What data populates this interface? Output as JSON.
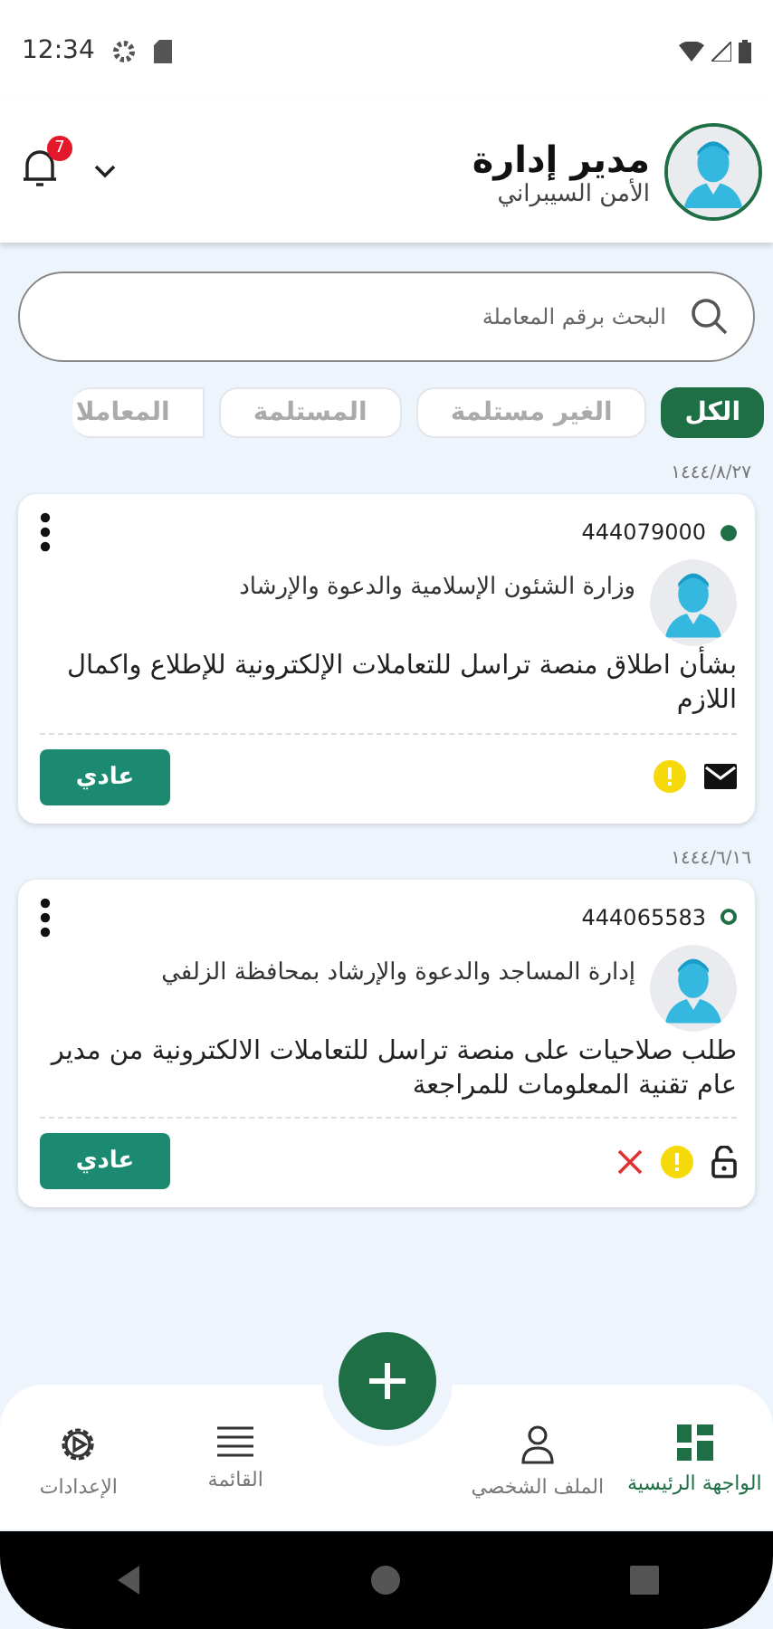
{
  "status_bar": {
    "time": "12:34"
  },
  "header": {
    "title": "مدير إدارة",
    "subtitle": "الأمن السيبراني",
    "notifications": "7"
  },
  "search": {
    "placeholder": "البحث برقم المعاملة"
  },
  "tabs": [
    {
      "label": "الكل",
      "selected": true
    },
    {
      "label": "الغير مستلمة",
      "selected": false
    },
    {
      "label": "المستلمة",
      "selected": false
    },
    {
      "label": "المعاملا",
      "selected": false
    }
  ],
  "transactions": [
    {
      "date": "١٤٤٤/٨/٢٧",
      "number": "444079000",
      "dot_filled": true,
      "sender": "وزارة الشئون الإسلامية والدعوة والإرشاد",
      "subject": "بشأن اطلاق منصة تراسل للتعاملات الإلكترونية للإطلاع واكمال اللازم",
      "priority": "عادي",
      "icons": [
        {
          "kind": "mail"
        },
        {
          "kind": "warning"
        }
      ]
    },
    {
      "date": "١٤٤٤/٦/١٦",
      "number": "444065583",
      "dot_filled": false,
      "sender": "إدارة المساجد والدعوة والإرشاد بمحافظة الزلفي",
      "subject": "طلب صلاحيات على منصة تراسل للتعاملات الالكترونية من مدير عام تقنية المعلومات للمراجعة",
      "priority": "عادي",
      "icons": [
        {
          "kind": "lock"
        },
        {
          "kind": "warning"
        },
        {
          "kind": "cancel"
        }
      ]
    }
  ],
  "bottom_nav": [
    {
      "kind": "home",
      "label": "الواجهة الرئيسية",
      "selected": true
    },
    {
      "kind": "profile",
      "label": "الملف الشخصي",
      "selected": false
    },
    {
      "kind": "list",
      "label": "القائمة",
      "selected": false
    },
    {
      "kind": "settings",
      "label": "الإعدادات",
      "selected": false
    }
  ]
}
